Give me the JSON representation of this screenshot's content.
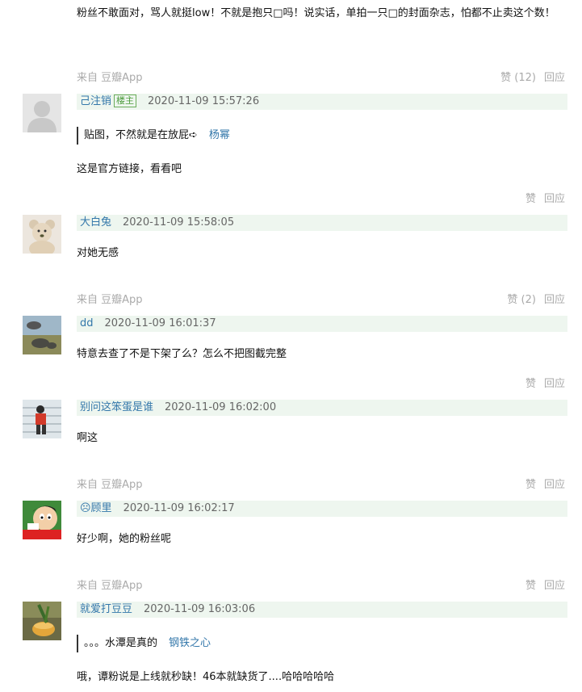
{
  "intro_text": "粉丝不敢面对，骂人就挺low！不就是抱只□吗！说实话，单拍一只□的封面杂志，怕都不止卖这个数！",
  "labels": {
    "like": "赞",
    "reply": "回应"
  },
  "comments": [
    {
      "source": "来自 豆瓣App",
      "likes": "赞 (12)",
      "reply": "回应"
    },
    {
      "author": "己注销",
      "badge": "楼主",
      "time": "2020-11-09 15:57:26",
      "quote": {
        "text": "贴图，不然就是在放屁➪",
        "author": "杨幂"
      },
      "content": "这是官方链接，看看吧",
      "footer": {
        "source": "",
        "likes": "赞",
        "reply": "回应"
      }
    },
    {
      "author": "大白兔",
      "time": "2020-11-09 15:58:05",
      "content": "对她无感",
      "footer": {
        "source": "来自 豆瓣App",
        "likes": "赞 (2)",
        "reply": "回应"
      }
    },
    {
      "author": "dd",
      "time": "2020-11-09 16:01:37",
      "content": "特意去查了不是下架了么？怎么不把图截完整",
      "footer": {
        "source": "",
        "likes": "赞",
        "reply": "回应"
      }
    },
    {
      "author": "别问这笨蛋是谁",
      "time": "2020-11-09 16:02:00",
      "content": "啊这",
      "footer": {
        "source": "来自 豆瓣App",
        "likes": "赞",
        "reply": "回应"
      }
    },
    {
      "author": "☹顾里",
      "time": "2020-11-09 16:02:17",
      "content": "好少啊，她的粉丝呢",
      "footer": {
        "source": "来自 豆瓣App",
        "likes": "赞",
        "reply": "回应"
      }
    },
    {
      "author": "就爱打豆豆",
      "time": "2020-11-09 16:03:06",
      "quote": {
        "text": "。。。水潭是真的",
        "author": "钢铁之心"
      },
      "content": "哦，谭粉说是上线就秒缺！46本就缺货了....哈哈哈哈哈"
    }
  ],
  "colors": {
    "author_link": "#3377aa",
    "header_bg": "#eef6ef",
    "meta_gray": "#aaaaaa",
    "badge_green": "#4a9a3a"
  }
}
